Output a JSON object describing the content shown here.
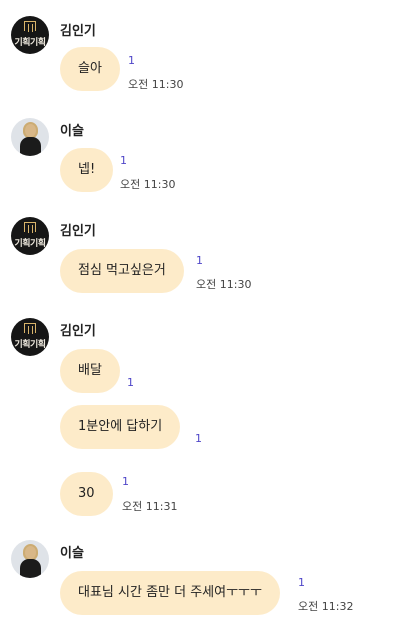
{
  "messages": [
    {
      "sender": "김인기",
      "avatar": "brand-logo",
      "text": "슬아",
      "unread": "1",
      "time": "오전 11:30"
    },
    {
      "sender": "이슬",
      "avatar": "profile-photo",
      "text": "넵!",
      "unread": "1",
      "time": "오전 11:30"
    },
    {
      "sender": "김인기",
      "avatar": "brand-logo",
      "text": "점심 먹고싶은거",
      "unread": "1",
      "time": "오전 11:30"
    },
    {
      "sender": "김인기",
      "avatar": "brand-logo",
      "text": "배달",
      "unread": "1"
    },
    {
      "text": "1분안에 답하기",
      "unread": "1"
    },
    {
      "text": "30",
      "unread": "1",
      "time": "오전 11:31"
    },
    {
      "sender": "이슬",
      "avatar": "profile-photo",
      "text": "대표님 시간 좀만 더 주세여ㅜㅜㅜ",
      "unread": "1",
      "time": "오전 11:32"
    }
  ],
  "logo_text": "기획기획",
  "colors": {
    "bubble": "#fdebc9",
    "unread": "#4f46c8",
    "logo_bg": "#161616",
    "logo_accent": "#d9b46a"
  }
}
